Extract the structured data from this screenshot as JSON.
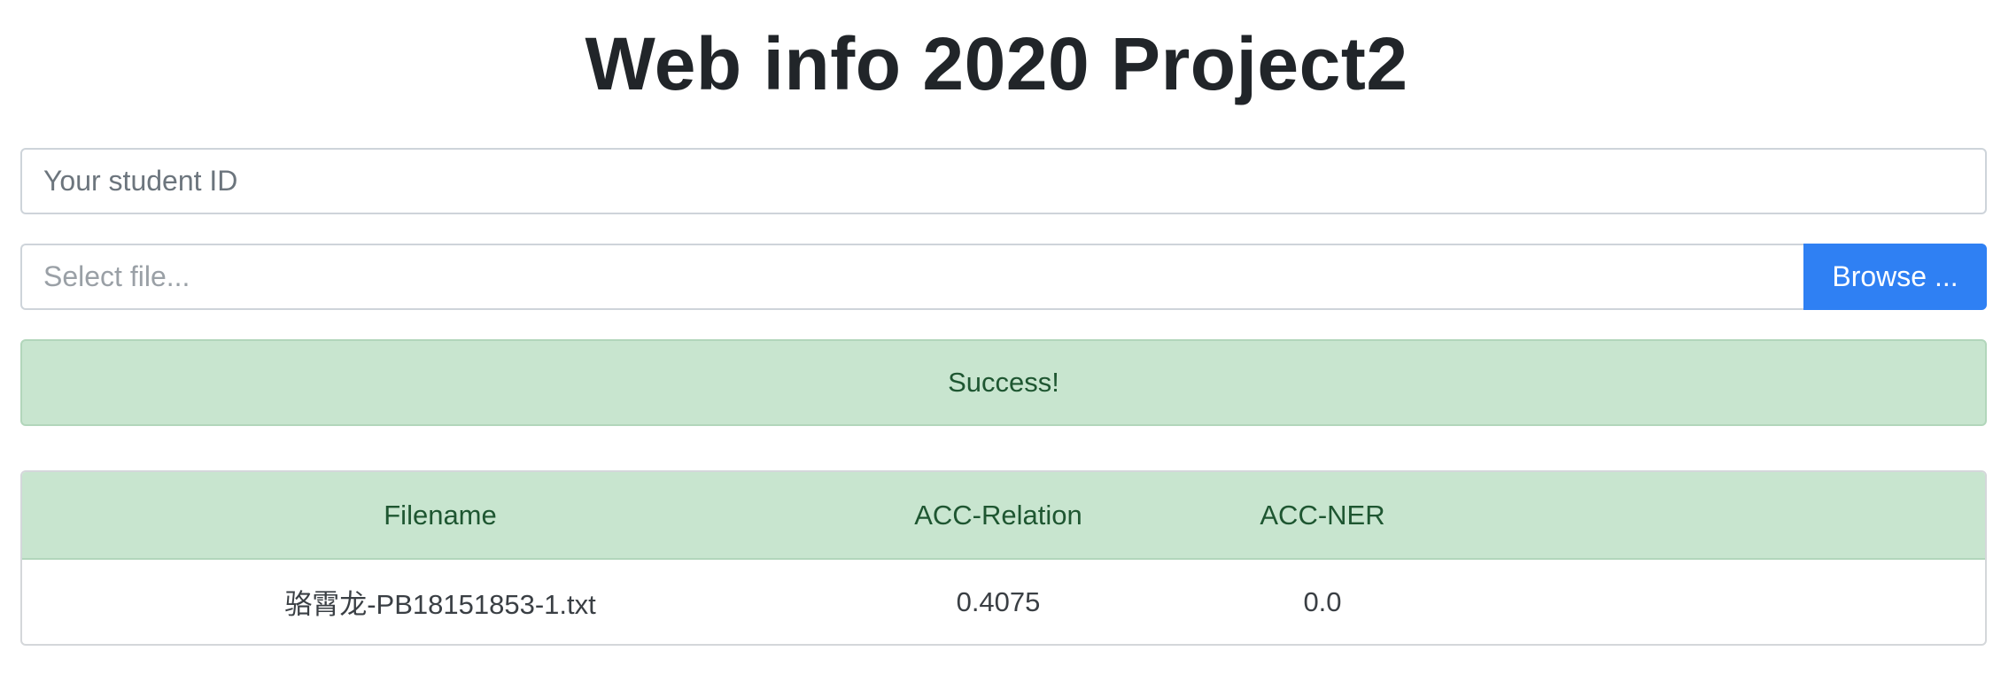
{
  "header": {
    "title": "Web info 2020 Project2"
  },
  "form": {
    "student_id_placeholder": "Your student ID",
    "student_id_value": "",
    "file_placeholder": "Select file...",
    "file_value": "",
    "browse_label": "Browse ..."
  },
  "alert": {
    "message": "Success!",
    "color": "#c8e5cf"
  },
  "results": {
    "columns": [
      "Filename",
      "ACC-Relation",
      "ACC-NER",
      ""
    ],
    "rows": [
      [
        "骆霄龙-PB18151853-1.txt",
        "0.4075",
        "0.0",
        ""
      ]
    ]
  },
  "colors": {
    "accent": "#2f80f3",
    "success_bg": "#c8e5cf",
    "success_text": "#1e5631",
    "title_text": "#212529"
  }
}
